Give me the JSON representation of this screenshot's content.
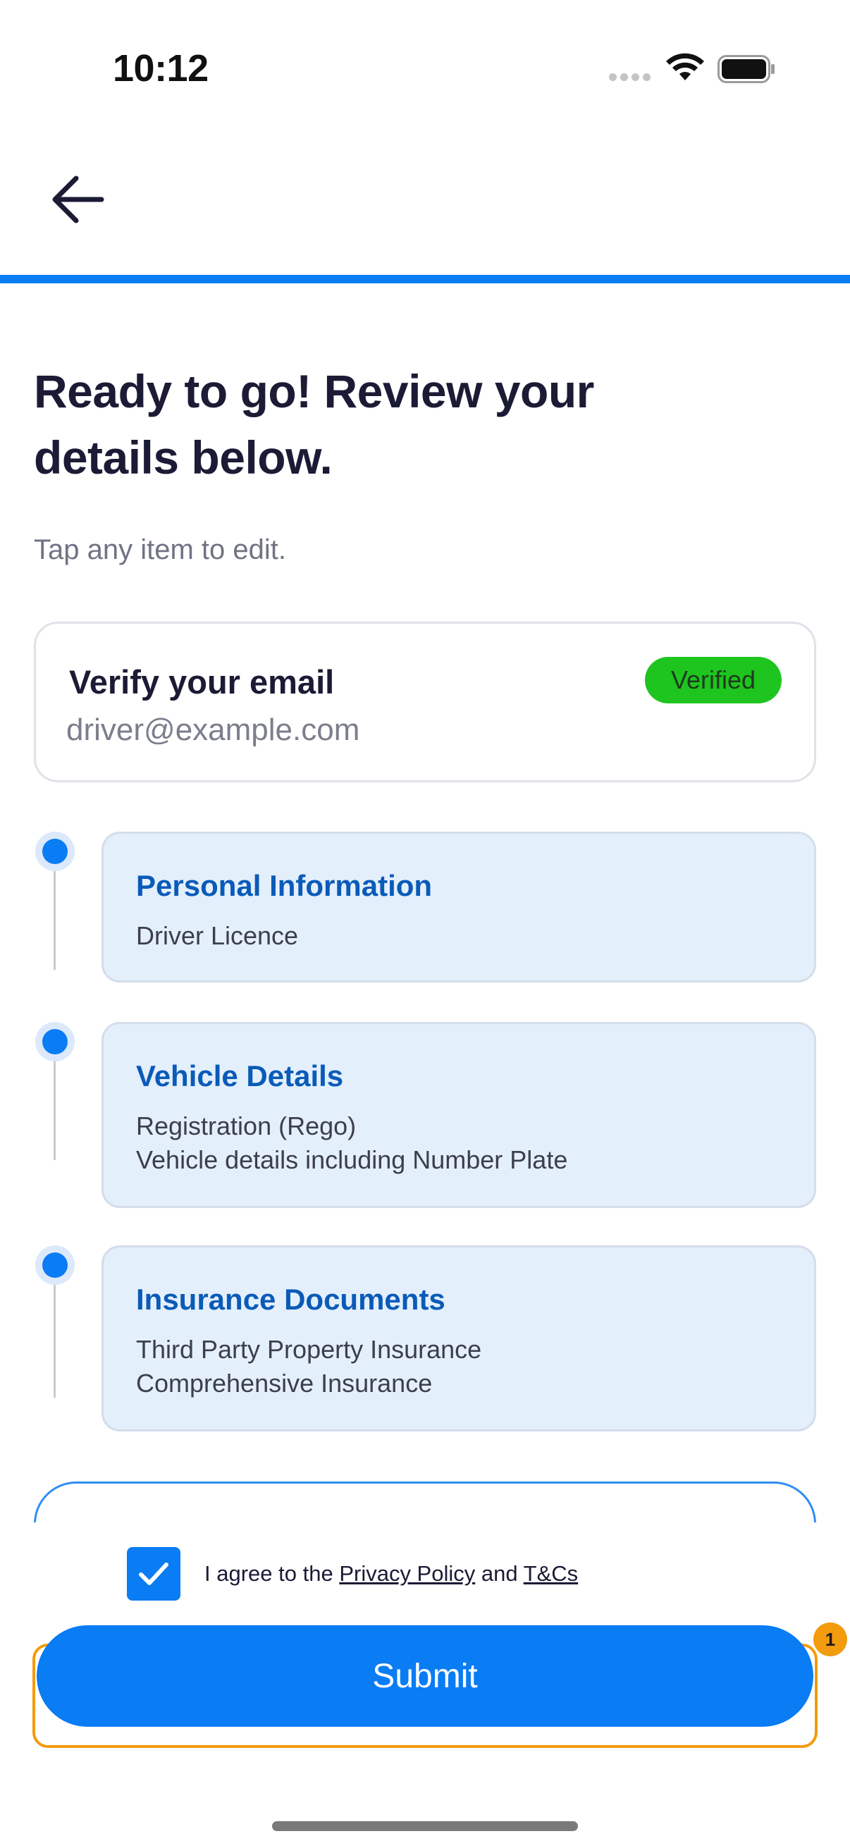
{
  "status_bar": {
    "time": "10:12",
    "icons": [
      "signal-dots-icon",
      "wifi-icon",
      "battery-icon"
    ]
  },
  "header": {
    "back_icon": "arrow-left-icon",
    "progress_percent": 100
  },
  "main": {
    "title": "Ready to go! Review your details below.",
    "subtitle": "Tap any item to edit."
  },
  "email_card": {
    "title": "Verify your email",
    "value": "driver@example.com",
    "badge": "Verified"
  },
  "steps": [
    {
      "title": "Personal Information",
      "lines": [
        "Driver Licence"
      ]
    },
    {
      "title": "Vehicle Details",
      "lines": [
        "Registration (Rego)",
        "Vehicle details including Number Plate"
      ]
    },
    {
      "title": "Insurance Documents",
      "lines": [
        "Third Party Property Insurance",
        "Comprehensive Insurance"
      ]
    }
  ],
  "footer": {
    "agree_prefix": "I agree to the ",
    "privacy_policy": "Privacy Policy",
    "agree_and": " and ",
    "terms": "T&Cs",
    "checkbox_checked": true,
    "submit_label": "Submit",
    "notification_count": "1"
  },
  "colors": {
    "accent": "#0a7cf4",
    "verified": "#1ec51e",
    "highlight": "#f29b0d",
    "card_bg": "#e4effc",
    "step_title": "#0a5bb8"
  }
}
